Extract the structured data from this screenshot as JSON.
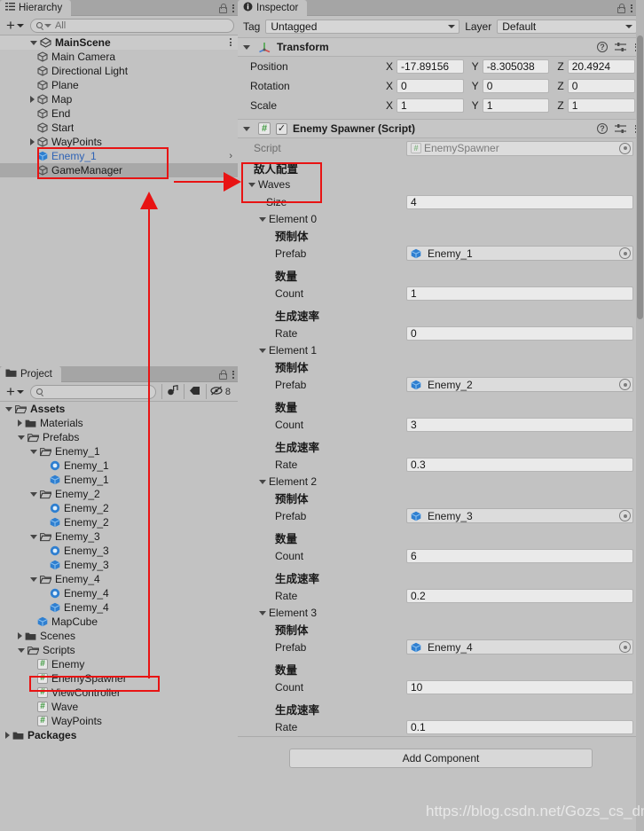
{
  "hierarchy": {
    "tab_label": "Hierarchy",
    "search_placeholder": "All",
    "scene_name": "MainScene",
    "items": [
      {
        "label": "Main Camera",
        "depth": 2,
        "expandable": false,
        "icon": "gameobject-icon",
        "selected": false,
        "prefab": false
      },
      {
        "label": "Directional Light",
        "depth": 2,
        "expandable": false,
        "icon": "gameobject-icon",
        "selected": false,
        "prefab": false
      },
      {
        "label": "Plane",
        "depth": 2,
        "expandable": false,
        "icon": "gameobject-icon",
        "selected": false,
        "prefab": false
      },
      {
        "label": "Map",
        "depth": 2,
        "expandable": true,
        "icon": "gameobject-icon",
        "selected": false,
        "prefab": false
      },
      {
        "label": "End",
        "depth": 2,
        "expandable": false,
        "icon": "gameobject-icon",
        "selected": false,
        "prefab": false
      },
      {
        "label": "Start",
        "depth": 2,
        "expandable": false,
        "icon": "gameobject-icon",
        "selected": false,
        "prefab": false
      },
      {
        "label": "WayPoints",
        "depth": 2,
        "expandable": true,
        "icon": "gameobject-icon",
        "selected": false,
        "prefab": false
      },
      {
        "label": "Enemy_1",
        "depth": 2,
        "expandable": false,
        "icon": "prefab-icon",
        "selected": false,
        "prefab": true
      },
      {
        "label": "GameManager",
        "depth": 2,
        "expandable": false,
        "icon": "gameobject-icon",
        "selected": true,
        "prefab": false
      }
    ]
  },
  "project": {
    "tab_label": "Project",
    "search_placeholder": "",
    "filter_count": "8",
    "items": [
      {
        "label": "Assets",
        "depth": 0,
        "icon": "folder-open-icon",
        "expandable": true,
        "expanded": true,
        "bold": true,
        "highlight": false
      },
      {
        "label": "Materials",
        "depth": 1,
        "icon": "folder-icon",
        "expandable": true,
        "expanded": false,
        "bold": false,
        "highlight": false
      },
      {
        "label": "Prefabs",
        "depth": 1,
        "icon": "folder-open-icon",
        "expandable": true,
        "expanded": true,
        "bold": false,
        "highlight": false
      },
      {
        "label": "Enemy_1",
        "depth": 2,
        "icon": "folder-open-icon",
        "expandable": true,
        "expanded": true,
        "bold": false,
        "highlight": false
      },
      {
        "label": "Enemy_1",
        "depth": 3,
        "icon": "material-icon",
        "expandable": false,
        "expanded": false,
        "bold": false,
        "highlight": false
      },
      {
        "label": "Enemy_1",
        "depth": 3,
        "icon": "prefab-icon",
        "expandable": false,
        "expanded": false,
        "bold": false,
        "highlight": false
      },
      {
        "label": "Enemy_2",
        "depth": 2,
        "icon": "folder-open-icon",
        "expandable": true,
        "expanded": true,
        "bold": false,
        "highlight": false
      },
      {
        "label": "Enemy_2",
        "depth": 3,
        "icon": "material-icon",
        "expandable": false,
        "expanded": false,
        "bold": false,
        "highlight": false
      },
      {
        "label": "Enemy_2",
        "depth": 3,
        "icon": "prefab-icon",
        "expandable": false,
        "expanded": false,
        "bold": false,
        "highlight": false
      },
      {
        "label": "Enemy_3",
        "depth": 2,
        "icon": "folder-open-icon",
        "expandable": true,
        "expanded": true,
        "bold": false,
        "highlight": false
      },
      {
        "label": "Enemy_3",
        "depth": 3,
        "icon": "material-icon",
        "expandable": false,
        "expanded": false,
        "bold": false,
        "highlight": false
      },
      {
        "label": "Enemy_3",
        "depth": 3,
        "icon": "prefab-icon",
        "expandable": false,
        "expanded": false,
        "bold": false,
        "highlight": false
      },
      {
        "label": "Enemy_4",
        "depth": 2,
        "icon": "folder-open-icon",
        "expandable": true,
        "expanded": true,
        "bold": false,
        "highlight": false
      },
      {
        "label": "Enemy_4",
        "depth": 3,
        "icon": "material-icon",
        "expandable": false,
        "expanded": false,
        "bold": false,
        "highlight": false
      },
      {
        "label": "Enemy_4",
        "depth": 3,
        "icon": "prefab-icon",
        "expandable": false,
        "expanded": false,
        "bold": false,
        "highlight": false
      },
      {
        "label": "MapCube",
        "depth": 2,
        "icon": "prefab-icon",
        "expandable": false,
        "expanded": false,
        "bold": false,
        "highlight": false
      },
      {
        "label": "Scenes",
        "depth": 1,
        "icon": "folder-icon",
        "expandable": true,
        "expanded": false,
        "bold": false,
        "highlight": false
      },
      {
        "label": "Scripts",
        "depth": 1,
        "icon": "folder-open-icon",
        "expandable": true,
        "expanded": true,
        "bold": false,
        "highlight": false
      },
      {
        "label": "Enemy",
        "depth": 2,
        "icon": "csharp-icon",
        "expandable": false,
        "expanded": false,
        "bold": false,
        "highlight": false
      },
      {
        "label": "EnemySpawner",
        "depth": 2,
        "icon": "csharp-icon",
        "expandable": false,
        "expanded": false,
        "bold": false,
        "highlight": true
      },
      {
        "label": "ViewController",
        "depth": 2,
        "icon": "csharp-icon",
        "expandable": false,
        "expanded": false,
        "bold": false,
        "highlight": false
      },
      {
        "label": "Wave",
        "depth": 2,
        "icon": "csharp-icon",
        "expandable": false,
        "expanded": false,
        "bold": false,
        "highlight": false
      },
      {
        "label": "WayPoints",
        "depth": 2,
        "icon": "csharp-icon",
        "expandable": false,
        "expanded": false,
        "bold": false,
        "highlight": false
      },
      {
        "label": "Packages",
        "depth": 0,
        "icon": "folder-icon",
        "expandable": true,
        "expanded": false,
        "bold": true,
        "highlight": false
      }
    ]
  },
  "inspector": {
    "tab_label": "Inspector",
    "tag_label": "Tag",
    "tag_value": "Untagged",
    "layer_label": "Layer",
    "layer_value": "Default",
    "transform": {
      "title": "Transform",
      "rows": [
        {
          "name": "Position",
          "x": "-17.89156",
          "y": "-8.305038",
          "z": "20.4924"
        },
        {
          "name": "Rotation",
          "x": "0",
          "y": "0",
          "z": "0"
        },
        {
          "name": "Scale",
          "x": "1",
          "y": "1",
          "z": "1"
        }
      ],
      "axes": [
        "X",
        "Y",
        "Z"
      ]
    },
    "spawner": {
      "title": "Enemy Spawner (Script)",
      "enabled": true,
      "script_label": "Script",
      "script_value": "EnemySpawner",
      "group_header_cn": "敌人配置",
      "array_label": "Waves",
      "size_label": "Size",
      "size_value": "4",
      "elements": [
        {
          "element_label": "Element 0",
          "prefab_cn": "预制体",
          "prefab_label": "Prefab",
          "prefab_value": "Enemy_1",
          "count_cn": "数量",
          "count_label": "Count",
          "count_value": "1",
          "rate_cn": "生成速率",
          "rate_label": "Rate",
          "rate_value": "0"
        },
        {
          "element_label": "Element 1",
          "prefab_cn": "预制体",
          "prefab_label": "Prefab",
          "prefab_value": "Enemy_2",
          "count_cn": "数量",
          "count_label": "Count",
          "count_value": "3",
          "rate_cn": "生成速率",
          "rate_label": "Rate",
          "rate_value": "0.3"
        },
        {
          "element_label": "Element 2",
          "prefab_cn": "预制体",
          "prefab_label": "Prefab",
          "prefab_value": "Enemy_3",
          "count_cn": "数量",
          "count_label": "Count",
          "count_value": "6",
          "rate_cn": "生成速率",
          "rate_label": "Rate",
          "rate_value": "0.2"
        },
        {
          "element_label": "Element 3",
          "prefab_cn": "预制体",
          "prefab_label": "Prefab",
          "prefab_value": "Enemy_4",
          "count_cn": "数量",
          "count_label": "Count",
          "count_value": "10",
          "rate_cn": "生成速率",
          "rate_label": "Rate",
          "rate_value": "0.1"
        }
      ]
    },
    "add_component_label": "Add Component"
  },
  "watermark": "https://blog.csdn.net/Gozs_cs_dn",
  "colors": {
    "annotation_red": "#e81313",
    "panel_bg": "#c2c2c2",
    "selection": "#a8a8a8",
    "prefab_blue": "#3e8ddd"
  }
}
